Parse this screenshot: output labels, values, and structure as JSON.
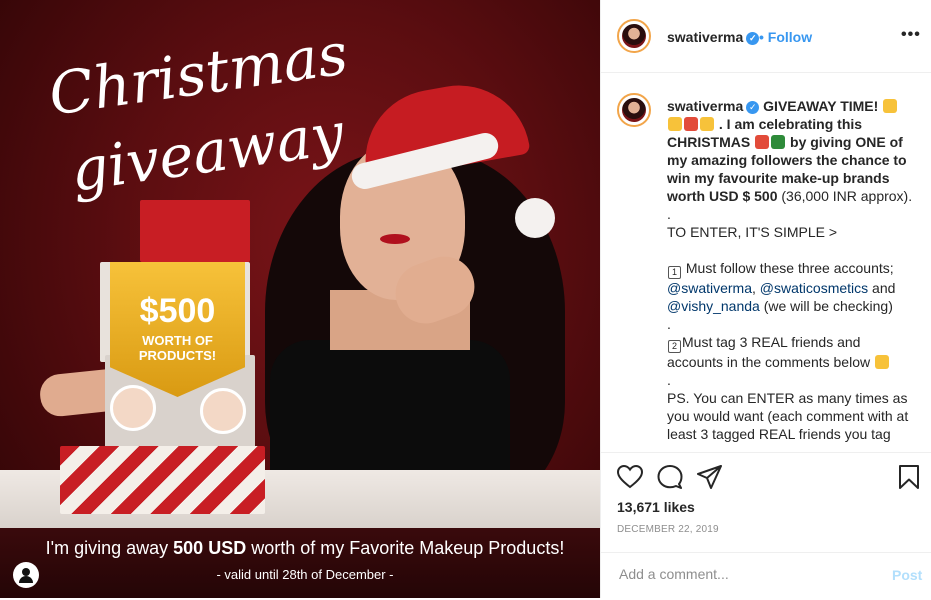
{
  "photo": {
    "script_line1": "Christmas",
    "script_line2": "giveaway",
    "price": "$500",
    "worth_line1": "WORTH OF",
    "worth_line2": "PRODUCTS!",
    "caption_pre": "I'm giving away ",
    "caption_bold": "500 USD",
    "caption_post": " worth of my Favorite Makeup Products!",
    "caption_sub": "- valid until 28th of December -"
  },
  "header": {
    "username": "swativerma",
    "follow_label": "Follow",
    "more_label": "•••"
  },
  "comment": {
    "username": "swativerma",
    "lines": {
      "giveaway": "GIVEAWAY TIME!",
      "celebrating": ". I am celebrating this",
      "christmas": "CHRISTMAS",
      "by_giving": "by giving ONE of my amazing followers the chance to win my favourite make-up brands worth USD $ 500",
      "approx": " (36,000 INR approx).",
      "dot1": ".",
      "to_enter": "TO ENTER, IT'S SIMPLE >",
      "rule1_num": "1",
      "rule1": " Must follow these three accounts;",
      "acct1": "@swativerma",
      "comma": ", ",
      "acct2": "@swaticosmetics",
      "and": " and",
      "acct3": "@vishy_nanda",
      "checking": " (we will be checking)",
      "dot2": ".",
      "rule2_num": "2",
      "rule2": "Must tag 3 REAL friends and accounts in the comments below",
      "dot3": ".",
      "ps": "PS. You can ENTER as many times as you would want (each comment with at least 3 tagged REAL friends you tag"
    }
  },
  "actions": {
    "likes": "13,671 likes",
    "date": "DECEMBER 22, 2019",
    "add_comment_placeholder": "Add a comment...",
    "post_label": "Post"
  },
  "colors": {
    "accent_blue": "#3897f0",
    "photo_bg": "#5a0d10",
    "text_dark": "#262626",
    "text_muted": "#8e8e8e"
  }
}
